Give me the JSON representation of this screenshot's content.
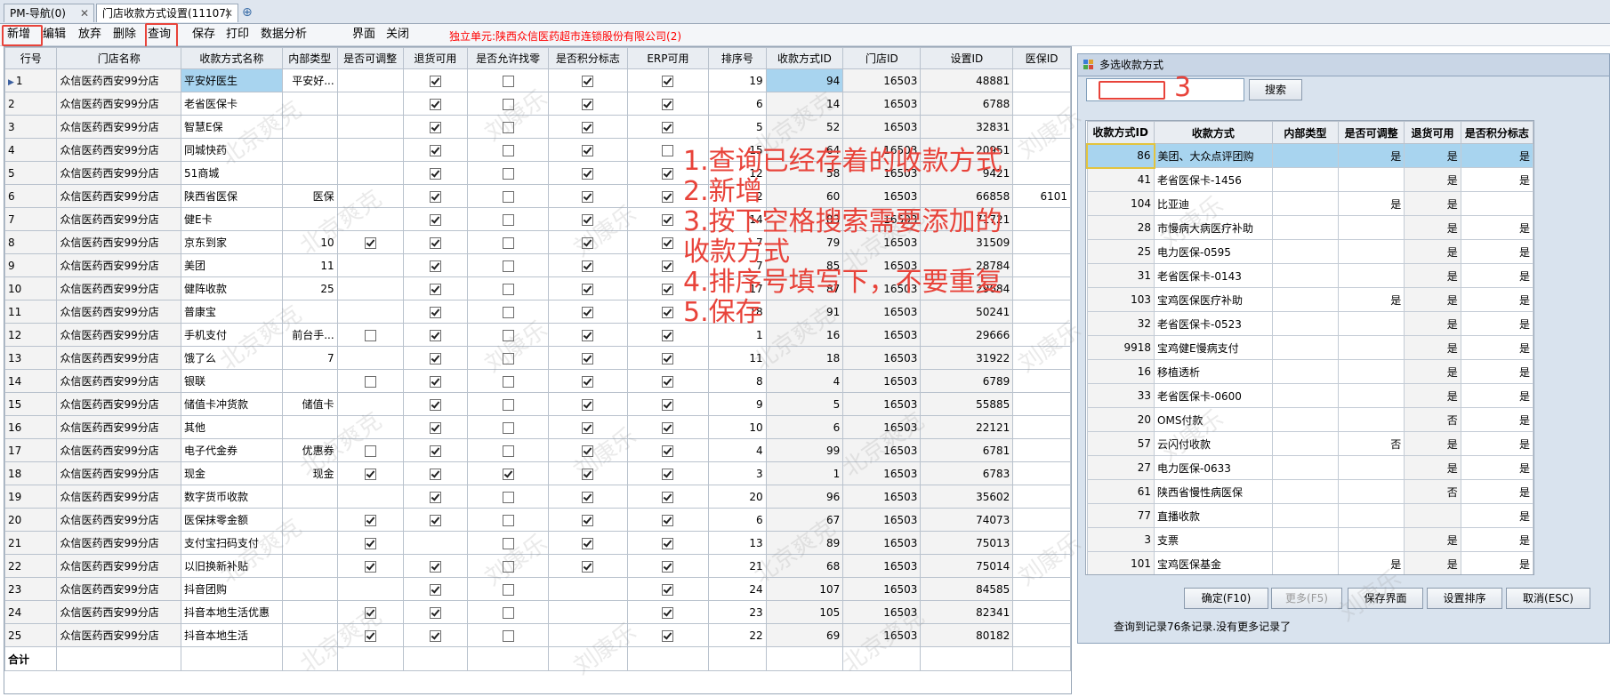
{
  "tabs": [
    {
      "label": "PM-导航(0)"
    },
    {
      "label": "门店收款方式设置(11107)"
    }
  ],
  "tab_close": "✕",
  "tab_add": "⊕",
  "toolbar": {
    "new": "新增",
    "edit": "编辑",
    "discard": "放弃",
    "delete": "删除",
    "query": "查询",
    "save": "保存",
    "print": "打印",
    "analysis": "数据分析",
    "layout": "界面",
    "close": "关闭",
    "unit": "独立单元:陕西众信医药超市连锁股份有限公司(2)"
  },
  "grid": {
    "headers": [
      "行号",
      "门店名称",
      "收款方式名称",
      "内部类型",
      "是否可调整",
      "退货可用",
      "是否允许找零",
      "是否积分标志",
      "ERP可用",
      "排序号",
      "收款方式ID",
      "门店ID",
      "设置ID",
      "医保ID"
    ],
    "rows": [
      {
        "no": "1",
        "store": "众信医药西安99分店",
        "name": "平安好医生",
        "inner": "平安好...",
        "adj": "",
        "ret": "on",
        "chg": "off",
        "pts": "on",
        "erp": "on",
        "sort": "19",
        "pid": "94",
        "sid": "16503",
        "setid": "48881",
        "yb": ""
      },
      {
        "no": "2",
        "store": "众信医药西安99分店",
        "name": "老省医保卡",
        "inner": "",
        "adj": "",
        "ret": "on",
        "chg": "off",
        "pts": "on",
        "erp": "on",
        "sort": "6",
        "pid": "14",
        "sid": "16503",
        "setid": "6788",
        "yb": ""
      },
      {
        "no": "3",
        "store": "众信医药西安99分店",
        "name": "智慧E保",
        "inner": "",
        "adj": "",
        "ret": "on",
        "chg": "off",
        "pts": "on",
        "erp": "on",
        "sort": "5",
        "pid": "52",
        "sid": "16503",
        "setid": "32831",
        "yb": ""
      },
      {
        "no": "4",
        "store": "众信医药西安99分店",
        "name": "同城快药",
        "inner": "",
        "adj": "",
        "ret": "on",
        "chg": "off",
        "pts": "on",
        "erp": "off",
        "sort": "15",
        "pid": "64",
        "sid": "16503",
        "setid": "20951",
        "yb": ""
      },
      {
        "no": "5",
        "store": "众信医药西安99分店",
        "name": "51商城",
        "inner": "",
        "adj": "",
        "ret": "on",
        "chg": "off",
        "pts": "on",
        "erp": "on",
        "sort": "12",
        "pid": "58",
        "sid": "16503",
        "setid": "9421",
        "yb": ""
      },
      {
        "no": "6",
        "store": "众信医药西安99分店",
        "name": "陕西省医保",
        "inner": "医保",
        "adj": "",
        "ret": "on",
        "chg": "off",
        "pts": "on",
        "erp": "on",
        "sort": "2",
        "pid": "60",
        "sid": "16503",
        "setid": "66858",
        "yb": "6101"
      },
      {
        "no": "7",
        "store": "众信医药西安99分店",
        "name": "健E卡",
        "inner": "",
        "adj": "",
        "ret": "on",
        "chg": "off",
        "pts": "on",
        "erp": "on",
        "sort": "14",
        "pid": "83",
        "sid": "16503",
        "setid": "71721",
        "yb": ""
      },
      {
        "no": "8",
        "store": "众信医药西安99分店",
        "name": "京东到家",
        "inner": "10",
        "adj": "on",
        "ret": "on",
        "chg": "off",
        "pts": "on",
        "erp": "on",
        "sort": "7",
        "pid": "79",
        "sid": "16503",
        "setid": "31509",
        "yb": ""
      },
      {
        "no": "9",
        "store": "众信医药西安99分店",
        "name": "美团",
        "inner": "11",
        "adj": "",
        "ret": "on",
        "chg": "off",
        "pts": "on",
        "erp": "on",
        "sort": "7",
        "pid": "85",
        "sid": "16503",
        "setid": "28784",
        "yb": ""
      },
      {
        "no": "10",
        "store": "众信医药西安99分店",
        "name": "健阵收款",
        "inner": "25",
        "adj": "",
        "ret": "on",
        "chg": "off",
        "pts": "on",
        "erp": "on",
        "sort": "17",
        "pid": "87",
        "sid": "16503",
        "setid": "29684",
        "yb": ""
      },
      {
        "no": "11",
        "store": "众信医药西安99分店",
        "name": "普康宝",
        "inner": "",
        "adj": "",
        "ret": "on",
        "chg": "off",
        "pts": "on",
        "erp": "on",
        "sort": "18",
        "pid": "91",
        "sid": "16503",
        "setid": "50241",
        "yb": ""
      },
      {
        "no": "12",
        "store": "众信医药西安99分店",
        "name": "手机支付",
        "inner": "前台手...",
        "adj": "off",
        "ret": "on",
        "chg": "off",
        "pts": "on",
        "erp": "on",
        "sort": "1",
        "pid": "16",
        "sid": "16503",
        "setid": "29666",
        "yb": ""
      },
      {
        "no": "13",
        "store": "众信医药西安99分店",
        "name": "饿了么",
        "inner": "7",
        "adj": "",
        "ret": "on",
        "chg": "off",
        "pts": "on",
        "erp": "on",
        "sort": "11",
        "pid": "18",
        "sid": "16503",
        "setid": "31922",
        "yb": ""
      },
      {
        "no": "14",
        "store": "众信医药西安99分店",
        "name": "银联",
        "inner": "",
        "adj": "off",
        "ret": "on",
        "chg": "off",
        "pts": "on",
        "erp": "on",
        "sort": "8",
        "pid": "4",
        "sid": "16503",
        "setid": "6789",
        "yb": ""
      },
      {
        "no": "15",
        "store": "众信医药西安99分店",
        "name": "储值卡冲货款",
        "inner": "储值卡",
        "adj": "",
        "ret": "on",
        "chg": "off",
        "pts": "on",
        "erp": "on",
        "sort": "9",
        "pid": "5",
        "sid": "16503",
        "setid": "55885",
        "yb": ""
      },
      {
        "no": "16",
        "store": "众信医药西安99分店",
        "name": "其他",
        "inner": "",
        "adj": "",
        "ret": "on",
        "chg": "off",
        "pts": "on",
        "erp": "on",
        "sort": "10",
        "pid": "6",
        "sid": "16503",
        "setid": "22121",
        "yb": ""
      },
      {
        "no": "17",
        "store": "众信医药西安99分店",
        "name": "电子代金券",
        "inner": "优惠券",
        "adj": "off",
        "ret": "on",
        "chg": "off",
        "pts": "on",
        "erp": "on",
        "sort": "4",
        "pid": "99",
        "sid": "16503",
        "setid": "6781",
        "yb": ""
      },
      {
        "no": "18",
        "store": "众信医药西安99分店",
        "name": "现金",
        "inner": "现金",
        "adj": "on",
        "ret": "on",
        "chg": "on",
        "pts": "on",
        "erp": "on",
        "sort": "3",
        "pid": "1",
        "sid": "16503",
        "setid": "6783",
        "yb": ""
      },
      {
        "no": "19",
        "store": "众信医药西安99分店",
        "name": "数字货币收款",
        "inner": "",
        "adj": "",
        "ret": "on",
        "chg": "off",
        "pts": "on",
        "erp": "on",
        "sort": "20",
        "pid": "96",
        "sid": "16503",
        "setid": "35602",
        "yb": ""
      },
      {
        "no": "20",
        "store": "众信医药西安99分店",
        "name": "医保抹零金额",
        "inner": "",
        "adj": "on",
        "ret": "on",
        "chg": "off",
        "pts": "on",
        "erp": "on",
        "sort": "6",
        "pid": "67",
        "sid": "16503",
        "setid": "74073",
        "yb": ""
      },
      {
        "no": "21",
        "store": "众信医药西安99分店",
        "name": "支付宝扫码支付",
        "inner": "",
        "adj": "on",
        "ret": "",
        "chg": "off",
        "pts": "on",
        "erp": "on",
        "sort": "13",
        "pid": "89",
        "sid": "16503",
        "setid": "75013",
        "yb": ""
      },
      {
        "no": "22",
        "store": "众信医药西安99分店",
        "name": "以旧换新补贴",
        "inner": "",
        "adj": "on",
        "ret": "on",
        "chg": "off",
        "pts": "on",
        "erp": "on",
        "sort": "21",
        "pid": "68",
        "sid": "16503",
        "setid": "75014",
        "yb": ""
      },
      {
        "no": "23",
        "store": "众信医药西安99分店",
        "name": "抖音团购",
        "inner": "",
        "adj": "",
        "ret": "on",
        "chg": "off",
        "pts": "",
        "erp": "on",
        "sort": "24",
        "pid": "107",
        "sid": "16503",
        "setid": "84585",
        "yb": ""
      },
      {
        "no": "24",
        "store": "众信医药西安99分店",
        "name": "抖音本地生活优惠",
        "inner": "",
        "adj": "on",
        "ret": "on",
        "chg": "off",
        "pts": "",
        "erp": "on",
        "sort": "23",
        "pid": "105",
        "sid": "16503",
        "setid": "82341",
        "yb": ""
      },
      {
        "no": "25",
        "store": "众信医药西安99分店",
        "name": "抖音本地生活",
        "inner": "",
        "adj": "on",
        "ret": "on",
        "chg": "off",
        "pts": "",
        "erp": "on",
        "sort": "22",
        "pid": "69",
        "sid": "16503",
        "setid": "80182",
        "yb": ""
      }
    ],
    "total_label": "合计"
  },
  "annotations": {
    "num1": "1",
    "num2": "2",
    "num3": "3",
    "instructions": [
      "1.查询已经存着的收款方式",
      "2.新增",
      "3.按下空格搜索需要添加的",
      "收款方式",
      "4.排序号填写下，不要重复",
      "5.保存"
    ]
  },
  "watermark": [
    "北京爽克",
    "刘康乐"
  ],
  "panel": {
    "title": "多选收款方式",
    "search_value": "",
    "search_button": "搜索",
    "headers": [
      "收款方式ID",
      "收款方式",
      "内部类型",
      "是否可调整",
      "退货可用",
      "是否积分标志"
    ],
    "rows": [
      {
        "id": "86",
        "name": "美团、大众点评团购",
        "inner": "",
        "adj": "是",
        "ret": "是",
        "pts": "是"
      },
      {
        "id": "41",
        "name": "老省医保卡-1456",
        "inner": "",
        "adj": "",
        "ret": "是",
        "pts": "是"
      },
      {
        "id": "104",
        "name": "比亚迪",
        "inner": "",
        "adj": "是",
        "ret": "是",
        "pts": ""
      },
      {
        "id": "28",
        "name": "市慢病大病医疗补助",
        "inner": "",
        "adj": "",
        "ret": "是",
        "pts": "是"
      },
      {
        "id": "25",
        "name": "电力医保-0595",
        "inner": "",
        "adj": "",
        "ret": "是",
        "pts": "是"
      },
      {
        "id": "31",
        "name": "老省医保卡-0143",
        "inner": "",
        "adj": "",
        "ret": "是",
        "pts": "是"
      },
      {
        "id": "103",
        "name": "宝鸡医保医疗补助",
        "inner": "",
        "adj": "是",
        "ret": "是",
        "pts": "是"
      },
      {
        "id": "32",
        "name": "老省医保卡-0523",
        "inner": "",
        "adj": "",
        "ret": "是",
        "pts": "是"
      },
      {
        "id": "9918",
        "name": "宝鸡健E慢病支付",
        "inner": "",
        "adj": "",
        "ret": "是",
        "pts": "是"
      },
      {
        "id": "16",
        "name": "移植透析",
        "inner": "",
        "adj": "",
        "ret": "是",
        "pts": "是"
      },
      {
        "id": "33",
        "name": "老省医保卡-0600",
        "inner": "",
        "adj": "",
        "ret": "是",
        "pts": "是"
      },
      {
        "id": "20",
        "name": "OMS付款",
        "inner": "",
        "adj": "",
        "ret": "否",
        "pts": "是"
      },
      {
        "id": "57",
        "name": "云闪付收款",
        "inner": "",
        "adj": "否",
        "ret": "是",
        "pts": "是"
      },
      {
        "id": "27",
        "name": "电力医保-0633",
        "inner": "",
        "adj": "",
        "ret": "是",
        "pts": "是"
      },
      {
        "id": "61",
        "name": "陕西省慢性病医保",
        "inner": "",
        "adj": "",
        "ret": "否",
        "pts": "是"
      },
      {
        "id": "77",
        "name": "直播收款",
        "inner": "",
        "adj": "",
        "ret": "",
        "pts": "是"
      },
      {
        "id": "3",
        "name": "支票",
        "inner": "",
        "adj": "",
        "ret": "是",
        "pts": "是"
      },
      {
        "id": "101",
        "name": "宝鸡医保基金",
        "inner": "",
        "adj": "是",
        "ret": "是",
        "pts": "是"
      }
    ],
    "buttons": {
      "ok": "确定(F10)",
      "more": "更多(F5)",
      "save_layout": "保存界面",
      "set_sort": "设置排序",
      "cancel": "取消(ESC)"
    },
    "status": "查询到记录76条记录.没有更多记录了"
  },
  "colors": {
    "selection": "#a8d4ef",
    "annotation_red": "#e8433a",
    "unit_red": "#ff0000"
  }
}
